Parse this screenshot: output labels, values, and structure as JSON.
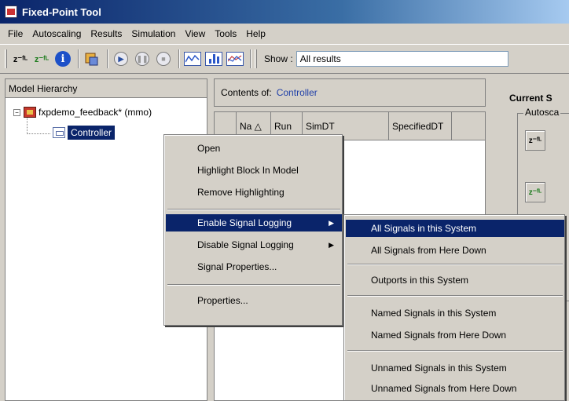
{
  "window": {
    "title": "Fixed-Point Tool"
  },
  "menubar": [
    "File",
    "Autoscaling",
    "Results",
    "Simulation",
    "View",
    "Tools",
    "Help"
  ],
  "toolbar": {
    "show_label": "Show :",
    "show_value": "All results",
    "propose_label": "z⁻ᶠᴸ",
    "apply_label": "z⁻ᶠᴸ",
    "info_label": "i"
  },
  "model_hierarchy": {
    "header": "Model Hierarchy",
    "root": "fxpdemo_feedback* (mmo)",
    "child": "Controller",
    "expander": "−"
  },
  "contents": {
    "label": "Contents of:",
    "system": "Controller",
    "columns": [
      "Na △",
      "Run",
      "SimDT",
      "SpecifiedDT"
    ]
  },
  "right_panel": {
    "title": "Current S",
    "group": "Autosca"
  },
  "context_menu": {
    "items": [
      "Open",
      "Highlight Block In Model",
      "Remove Highlighting",
      "Enable Signal Logging",
      "Disable Signal Logging",
      "Signal Properties...",
      "Properties..."
    ],
    "arrow": "▶"
  },
  "submenu": {
    "items": [
      "All Signals in this System",
      "All Signals from Here Down",
      "Outports in this System",
      "Named Signals in this System",
      "Named Signals from Here Down",
      "Unnamed Signals in this System",
      "Unnamed Signals from Here Down"
    ]
  },
  "colors": {
    "selection": "#0a246a",
    "link": "#1f3fa8",
    "title_start": "#0a246a",
    "title_end": "#a6caf0"
  },
  "icons": [
    "app-icon",
    "propose-fl-icon",
    "apply-fl-icon",
    "info-icon",
    "model-advisor-icon",
    "play-icon",
    "pause-icon",
    "stop-icon",
    "plot-signal-icon",
    "histogram-icon",
    "compare-icon",
    "model-icon",
    "subsystem-icon",
    "submenu-arrow-icon"
  ]
}
